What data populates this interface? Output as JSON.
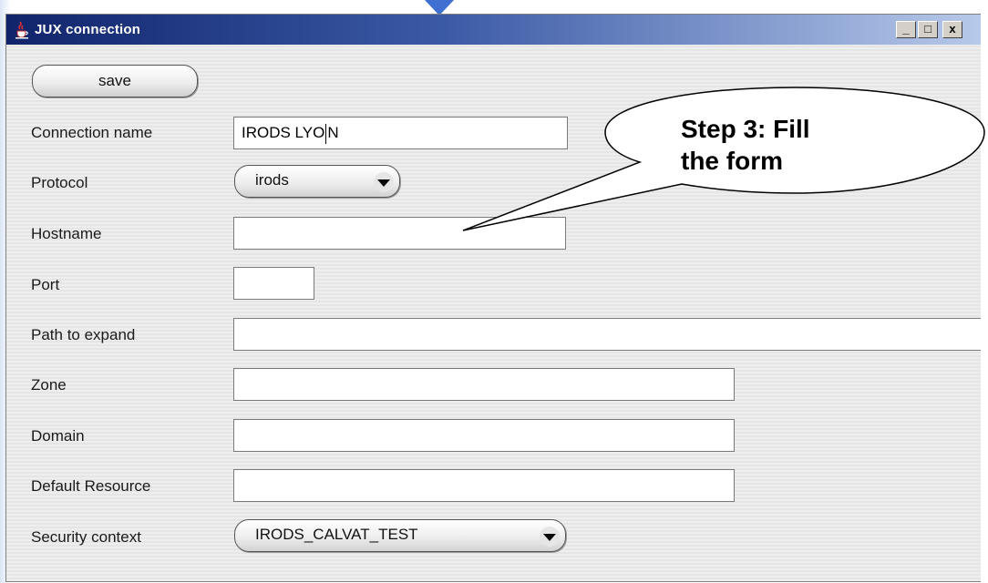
{
  "window": {
    "title": "JUX connection",
    "controls": {
      "minimize": "_",
      "maximize": "□",
      "close": "x"
    }
  },
  "toolbar": {
    "save_label": "save"
  },
  "form": {
    "connection_name": {
      "label": "Connection name",
      "value": "IRODS LYO",
      "value_after_caret": "N"
    },
    "protocol": {
      "label": "Protocol",
      "selected": "irods"
    },
    "hostname": {
      "label": "Hostname",
      "value": ""
    },
    "port": {
      "label": "Port",
      "value": ""
    },
    "path_to_expand": {
      "label": "Path to expand",
      "value": ""
    },
    "zone": {
      "label": "Zone",
      "value": ""
    },
    "domain": {
      "label": "Domain",
      "value": ""
    },
    "default_resource": {
      "label": "Default Resource",
      "value": ""
    },
    "security_context": {
      "label": "Security context",
      "selected": "IRODS_CALVAT_TEST"
    }
  },
  "callout": {
    "line1": "Step 3: Fill",
    "line2": "the form"
  },
  "colors": {
    "titlebar_start": "#10246b",
    "titlebar_end": "#b7c9ea",
    "pointer_arrow": "#3f6fd0"
  },
  "icons": {
    "title_icon": "java-cup-icon",
    "dropdown_icon": "chevron-down-icon"
  }
}
